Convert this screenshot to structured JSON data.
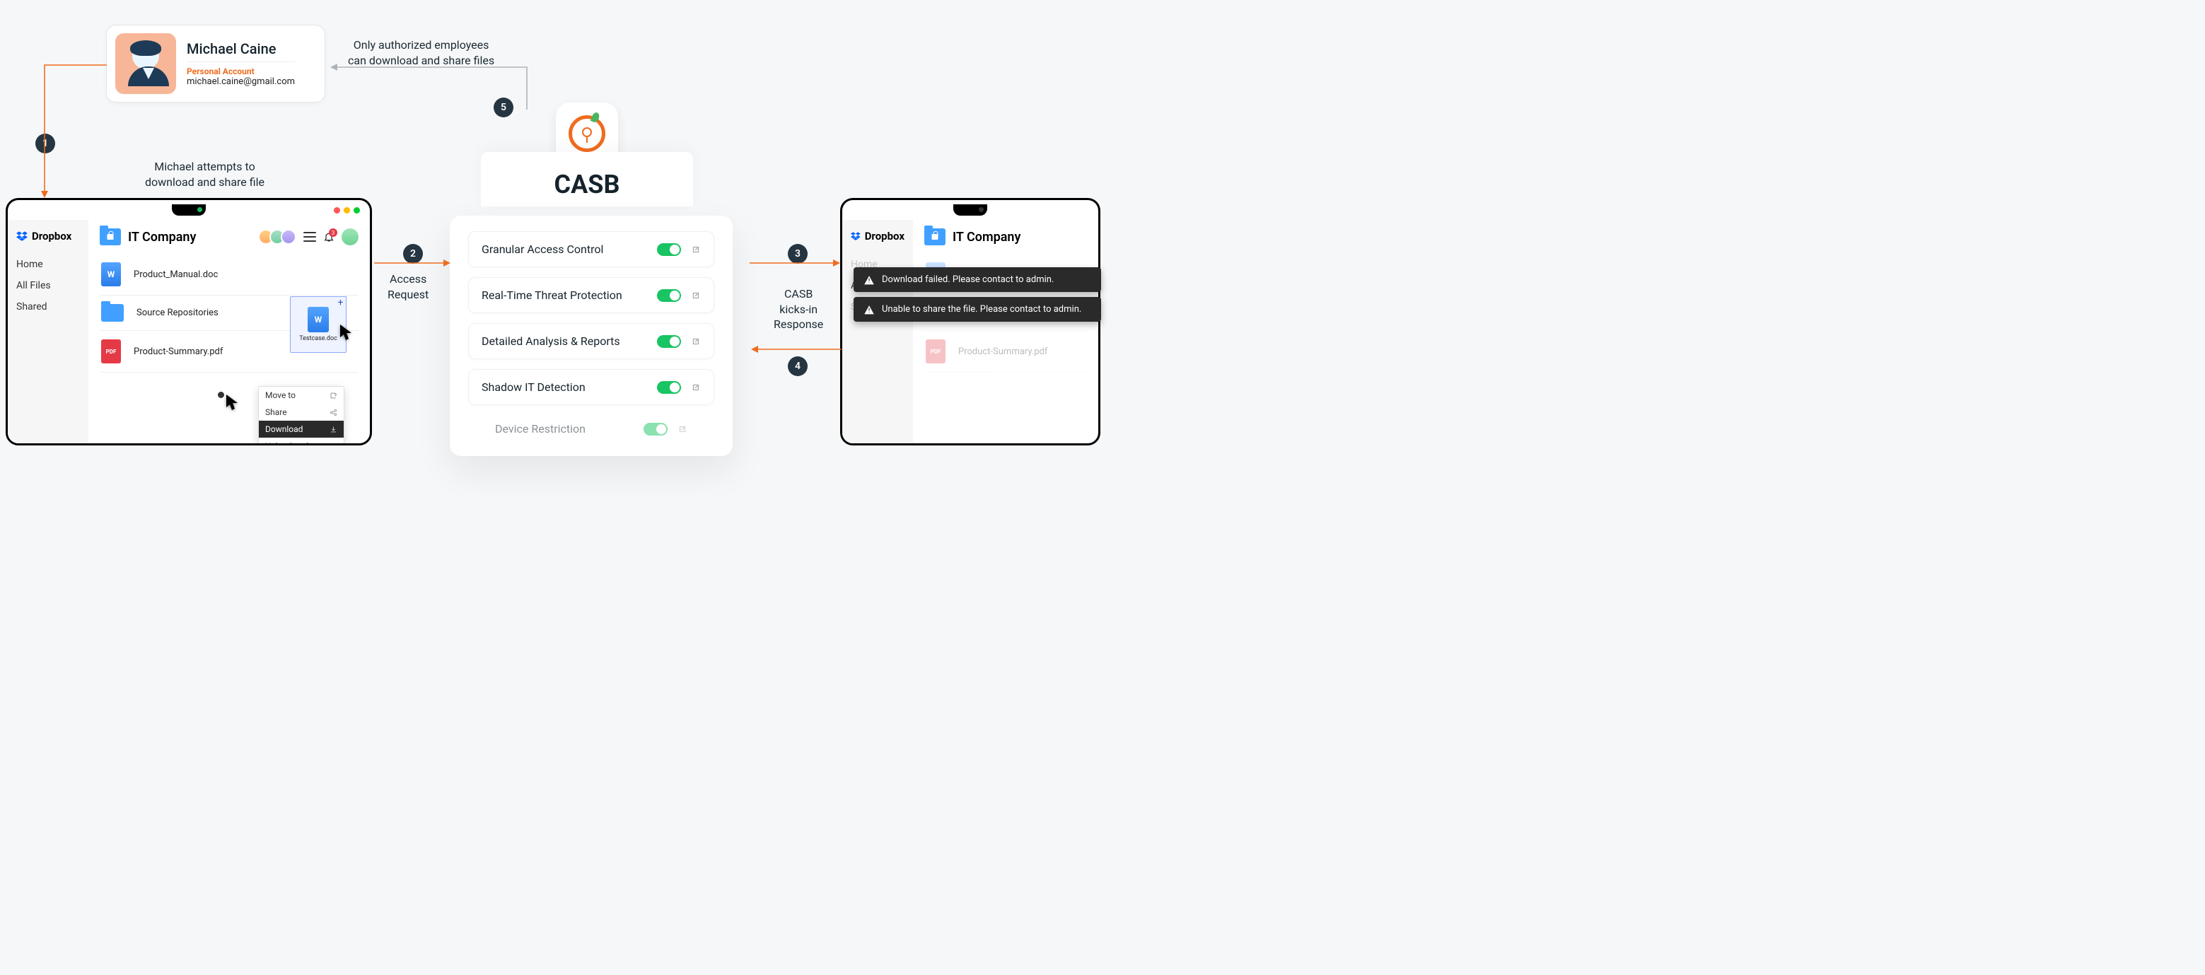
{
  "user": {
    "name": "Michael Caine",
    "account_type": "Personal Account",
    "email": "michael.caine@gmail.com"
  },
  "steps": {
    "s1": "1",
    "s2": "2",
    "s3": "3",
    "s4": "4",
    "s5": "5"
  },
  "annotations": {
    "authorized_note_l1": "Only authorized employees",
    "authorized_note_l2": "can download and share files",
    "attempt_l1": "Michael attempts to",
    "attempt_l2": "download and share file",
    "access_l1": "Access",
    "access_l2": "Request",
    "resp_l1": "CASB",
    "resp_l2": "kicks-in",
    "resp_l3": "Response"
  },
  "casb": {
    "title": "CASB",
    "features": [
      {
        "label": "Granular Access Control"
      },
      {
        "label": "Real-Time Threat Protection"
      },
      {
        "label": "Detailed Analysis  & Reports"
      },
      {
        "label": "Shadow IT Detection"
      }
    ],
    "faded_feature": "Device Restriction"
  },
  "dropbox": {
    "brand": "Dropbox",
    "nav": {
      "home": "Home",
      "all": "All Files",
      "shared": "Shared"
    },
    "folder": "IT Company",
    "notif_count": "3",
    "files": [
      {
        "name": "Product_Manual.doc",
        "type": "word"
      },
      {
        "name": "Source Repositories",
        "type": "folder"
      },
      {
        "name": "Product-Summary.pdf",
        "type": "pdf"
      }
    ],
    "drag_file": "Testcase.doc",
    "ctx": {
      "move": "Move to",
      "share": "Share",
      "download": "Download",
      "upload": "Upload or drop"
    }
  },
  "errors": {
    "download": "Download failed. Please contact to admin.",
    "share": "Unable to share the file. Please contact to admin."
  }
}
